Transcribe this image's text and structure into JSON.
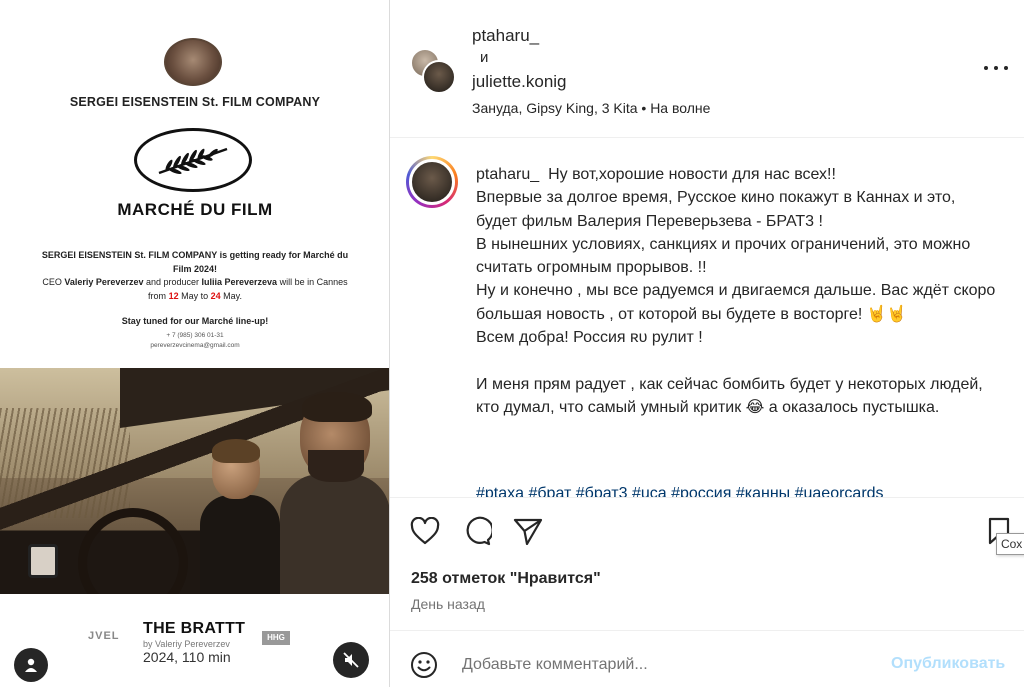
{
  "poster": {
    "company": "SERGEI EISENSTEIN St. FILM COMPANY",
    "marche": "MARCHÉ DU FILM",
    "line1": "SERGEI EISENSTEIN St. FILM COMPANY is getting ready for Marché du Film 2024!",
    "line2a": "CEO ",
    "ceo": "Valeriy Pereverzev",
    "line2b": " and producer ",
    "producer": "Iuliia Pereverzeva",
    "line2c": " will be in Cannes from ",
    "date_from": "12",
    "line2d": " May to ",
    "date_to": "24",
    "line2e": " May.",
    "stay_tuned": "Stay tuned for our Marché line-up!",
    "phone": "+ 7 (985) 306 01-31",
    "email": "pereverzevcinema@gmail.com",
    "logo_left": "JVEL",
    "film_title": "THE BRATTT",
    "byline": "by Valeriy Pereverzev",
    "year_runtime": "2024, 110 min",
    "logo_right": "HHG"
  },
  "header": {
    "user1": "ptaharu_",
    "and": "и",
    "user2": "juliette.konig",
    "audio": "Зануда, Gipsy King, 3 Kita • На волне"
  },
  "caption": {
    "username": "ptaharu_",
    "text": "  Ну вот,хорошие новости для нас всех!!\nВпервые за долгое время, Русское кино покажут в Каннах и это, будет фильм Валерия Переверьзева - БРАТ3 !\nВ нынешних условиях, санкциях и прочих ограничений, это можно считать огромным прорывов. !!\nНу и конечно , мы все радуемся и двигаемся дальше. Вас ждёт скоро большая новость , от которой вы будете в восторге! 🤘🤘\nВсем добра! Россия ʀᴜ рулит !\n\nИ меня прям радует , как сейчас бомбить будет у некоторых людей, кто думал, что самый умный критик 😂 а оказалось пустышка.",
    "hashtags": "#ptaxa #брат #брат3 #uca #россия #канны #uaeorcards"
  },
  "actions": {
    "save_tooltip": "Сох"
  },
  "likes_count": "258",
  "likes_label": " отметок \"Нравится\"",
  "time_ago": "День назад",
  "comment": {
    "placeholder": "Добавьте комментарий...",
    "publish": "Опубликовать"
  },
  "icons": [
    "heart-icon",
    "comment-icon",
    "share-icon",
    "bookmark-icon",
    "emoji-icon",
    "more-icon",
    "user-tag-icon",
    "mute-icon"
  ],
  "colors": {
    "accent_red": "#dd1111",
    "link": "#00376b",
    "publish_disabled": "#b2dffc",
    "muted_text": "#737373"
  }
}
